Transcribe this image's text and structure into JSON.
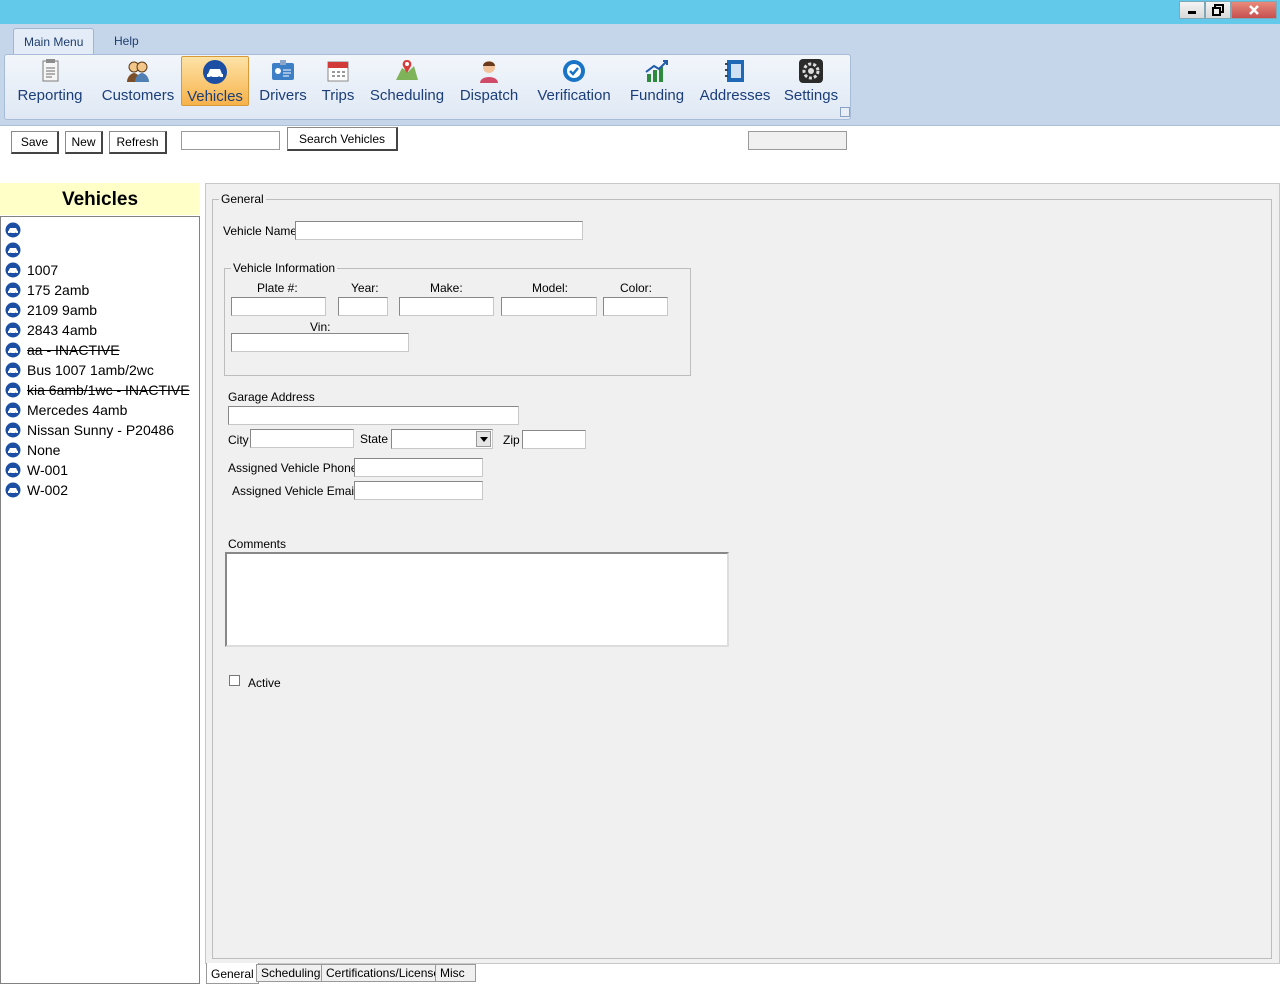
{
  "window": {
    "controls": {
      "minimize_icon": "minimize-icon",
      "restore_icon": "restore-icon",
      "close_icon": "close-icon"
    }
  },
  "ribbon": {
    "tabs": [
      {
        "label": "Main Menu",
        "active": true
      },
      {
        "label": "Help",
        "active": false
      }
    ],
    "buttons": [
      {
        "label": "Reporting",
        "icon": "report-icon"
      },
      {
        "label": "Customers",
        "icon": "customers-icon"
      },
      {
        "label": "Vehicles",
        "icon": "vehicle-icon",
        "active": true
      },
      {
        "label": "Drivers",
        "icon": "driver-badge-icon"
      },
      {
        "label": "Trips",
        "icon": "calendar-icon"
      },
      {
        "label": "Scheduling",
        "icon": "map-pin-icon"
      },
      {
        "label": "Dispatch",
        "icon": "dispatcher-icon"
      },
      {
        "label": "Verification",
        "icon": "check-badge-icon"
      },
      {
        "label": "Funding",
        "icon": "chart-growth-icon"
      },
      {
        "label": "Addresses",
        "icon": "address-book-icon"
      },
      {
        "label": "Settings",
        "icon": "gear-icon"
      }
    ],
    "colors": {
      "accent_active": "#f7b24b",
      "label": "#1b3e7a",
      "titlebar": "#63c9ea"
    }
  },
  "toolbar": {
    "save_label": "Save",
    "new_label": "New",
    "refresh_label": "Refresh",
    "search_value": "",
    "search_button_label": "Search Vehicles",
    "right_box_value": ""
  },
  "sidebar": {
    "title": "Vehicles",
    "items": [
      {
        "label": "",
        "inactive": false
      },
      {
        "label": "",
        "inactive": false
      },
      {
        "label": "1007",
        "inactive": false
      },
      {
        "label": "175 2amb",
        "inactive": false
      },
      {
        "label": "2109 9amb",
        "inactive": false
      },
      {
        "label": "2843 4amb",
        "inactive": false
      },
      {
        "label": "aa  - INACTIVE",
        "inactive": true
      },
      {
        "label": "Bus 1007 1amb/2wc",
        "inactive": false
      },
      {
        "label": "kia 6amb/1wc - INACTIVE",
        "inactive": true
      },
      {
        "label": "Mercedes 4amb",
        "inactive": false
      },
      {
        "label": "Nissan Sunny - P20486",
        "inactive": false
      },
      {
        "label": "None",
        "inactive": false
      },
      {
        "label": "W-001",
        "inactive": false
      },
      {
        "label": "W-002",
        "inactive": false
      }
    ]
  },
  "form": {
    "general_legend": "General",
    "vehicle_name_label": "Vehicle Name:",
    "vehicle_name_value": "",
    "vehicle_info": {
      "legend": "Vehicle Information",
      "plate_label": "Plate #:",
      "year_label": "Year:",
      "make_label": "Make:",
      "model_label": "Model:",
      "color_label": "Color:",
      "vin_label": "Vin:",
      "plate_value": "",
      "year_value": "",
      "make_value": "",
      "model_value": "",
      "color_value": "",
      "vin_value": ""
    },
    "garage_address_label": "Garage Address",
    "garage_address_value": "",
    "city_label": "City",
    "city_value": "",
    "state_label": "State",
    "state_value": "",
    "zip_label": "Zip",
    "zip_value": "",
    "phone_label": "Assigned Vehicle Phone",
    "phone_value": "",
    "email_label": "Assigned Vehicle Email",
    "email_value": "",
    "comments_label": "Comments",
    "comments_value": "",
    "active_label": "Active",
    "active_checked": false
  },
  "bottom_tabs": [
    {
      "label": "General",
      "active": true
    },
    {
      "label": "Scheduling",
      "active": false
    },
    {
      "label": "Certifications/License",
      "active": false
    },
    {
      "label": "Misc",
      "active": false
    }
  ]
}
